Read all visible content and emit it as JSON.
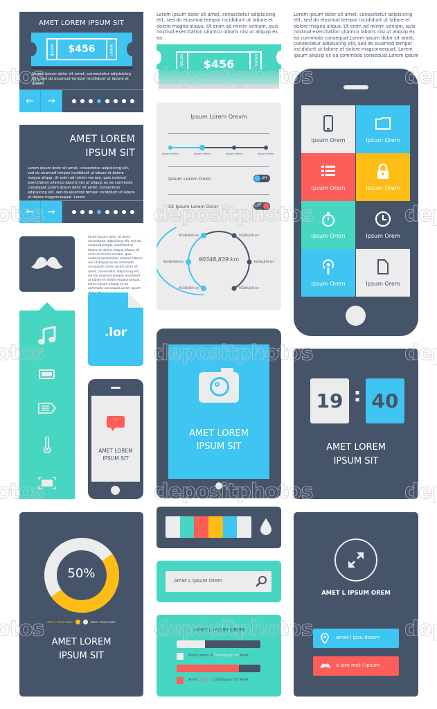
{
  "colors": {
    "dark": "#46546a",
    "blue": "#3ec5f1",
    "teal": "#47d6c1",
    "red": "#fd5e5a",
    "yellow": "#fdbd15",
    "light": "#ececec"
  },
  "ticket_card": {
    "title": "AMET LOREM IPSUM SIT",
    "price": "$456",
    "stub_left": "ipsum",
    "stub_right": "lorem",
    "text": "Lorem ipsum dolor sit amet, consectetur adipisicing elit, sed do eiusmod tempor incididunt ut labore et dolore",
    "prev_icon": "arrow-left-icon",
    "next_icon": "arrow-right-icon",
    "prev_glyph": "←",
    "next_glyph": "→",
    "pager_total": 8,
    "pager_active": 4
  },
  "top_text_middle": "Lorem ipsum dolor sit amet, consectetur adipisicing elit, sed do eiusmod tempor incididunt ut labore et dolore magna aliqua. Ut enim ad minim veniam, quis nostrud exercitation ullamco laboris nisi ut aliquip ex ea",
  "top_text_right": "Lorem ipsum dolor sit amet, consectetur adipisicing elit, sed do eiusmod tempor incididunt ut labore et dolore magna aliqua. Ut enim ad minim veniam, quis nostrud exercitation ullamco laboris nisi ut aliquip ex ea commodo consequat.Lorem ipsum dolor sit amet, consectetur adipisicing elit, sed do eiusmod tempor incididunt ut labore et dolore magconsequat. Lorem ipsum aliquip ex ea commodo consequat.Lorem ipsum",
  "teal_ticket": {
    "price": "$456",
    "stub_left": "ipsum",
    "stub_right": "lorem"
  },
  "slider_card": {
    "title": "AMET LOREM IPSUM SIT",
    "text": "Lorem ipsum dolor sit amet, consectetur adipisicing elit, sed do eiusmod tempor incididunt ut labore et dolore magna aliqua. Ut enim ad minim veniam, quis nostrud exercitation ullamco laboris nisi ut aliquip ex ea commodo consequat.Lorem ipsum dolor sit amet, consectetur adipisicing elit, sed do eiusmod tempor incididunt ut labore et dolore magconsequat. Lorem",
    "prev_glyph": "←",
    "next_glyph": "→",
    "pager_total": 8,
    "pager_active": 4
  },
  "mustache_text": "Lorem ipsum dolor sit amet, consectetur adipisicing elit, sed do eiusmod tempor incididunt ut labore et dolore magna aliqua. Ut enim ad minim veniam, quis nostrud exercitation ullamco laboris nisi ut aliquip ex ea commodo consequat.Lorem ipsum dolor sit amet, consectetur adipisicing elit, sed do eiusmod tempor incididunt ut labore et dolore magconsequat. Lorem ipsum aliquip ex ea commodo consequat.Lorem ipsum dolor sit",
  "settings_panel": {
    "title": "Ipsum Lorem Orevm",
    "steps": [
      "Ipsum Orem",
      "Ipsum Orem",
      "Ipsum Orem",
      "Ipsum Orem"
    ],
    "steps_completed": 2,
    "toggle1_label": "Ipsum Lorem Dolor",
    "toggle1_state": "on",
    "toggle2_label": "Sit Ipsum Lorem Dolor",
    "toggle2_state": "off",
    "gauge_value": "90348,839 km",
    "gauge_labels": [
      "90348,839 km",
      "90348,839 km",
      "90348,839 km",
      "90348,839 km",
      "90348,839 km",
      "90348,839 km"
    ],
    "gauge_progress": 0.5
  },
  "phone_grid": {
    "tiles": [
      {
        "label": "Ipsum Orem",
        "icon": "smartphone-icon"
      },
      {
        "label": "Ipsum Orem",
        "icon": "folder-icon"
      },
      {
        "label": "Ipsum Orem",
        "icon": "list-icon"
      },
      {
        "label": "Ipsum Orem",
        "icon": "lock-icon"
      },
      {
        "label": "Ipsum Orem",
        "icon": "stopwatch-icon"
      },
      {
        "label": "Ipsum Orem",
        "icon": "clock-icon"
      },
      {
        "label": "Ipsum Orem",
        "icon": "podcast-icon"
      },
      {
        "label": "Ipsum Orem",
        "icon": "document-icon"
      }
    ]
  },
  "side_toolbar": {
    "icons": [
      "music-icon",
      "battery-icon",
      "tag-icon",
      "thermometer-icon",
      "fullscreen-icon"
    ]
  },
  "file_icon": {
    "ext": ".lor"
  },
  "small_phone": {
    "title_line1": "AMET LOREM",
    "title_line2": "IPSUM SIT",
    "bubble": "···"
  },
  "tablet": {
    "title_line1": "AMET LOREM",
    "title_line2": "IPSUM SIT"
  },
  "clock_card": {
    "hours": "19",
    "separator": ":",
    "minutes": "40",
    "title_line1": "AMET LOREM",
    "title_line2": "IPSUM SIT"
  },
  "donut_card": {
    "percent_label": "50%",
    "value": 0.5,
    "legend_a": "AMET L IPSUM OREM",
    "legend_b": "AMET L IPSUM OREM",
    "title_line1": "AMET LOREM",
    "title_line2": "IPSUM SIT"
  },
  "palette": {
    "swatches": [
      "#ececec",
      "#47d6c1",
      "#fd5e5a",
      "#fdbd15",
      "#3ec5f1",
      "#ececec"
    ]
  },
  "search": {
    "value": "Amet L Ipsum Orem"
  },
  "progress_card": {
    "title": "AMET L IPSUM OREM",
    "bar1": 0.34,
    "bar2": 0.74,
    "legend1": [
      "Amet Lorem Ul ",
      "DolorIpsum Sit",
      " Amet"
    ],
    "legend2": [
      "Amet ",
      "Lorem Ul",
      " DolorIpsum Sit Amet"
    ]
  },
  "expand_card": {
    "title": "AMET L IPSUM OREM",
    "button1": "amet l ipsu dolom",
    "button2": "a lore met l ipsum"
  },
  "watermark": {
    "text": "depositphotos",
    "side": "otos",
    "side_r": "dep"
  }
}
